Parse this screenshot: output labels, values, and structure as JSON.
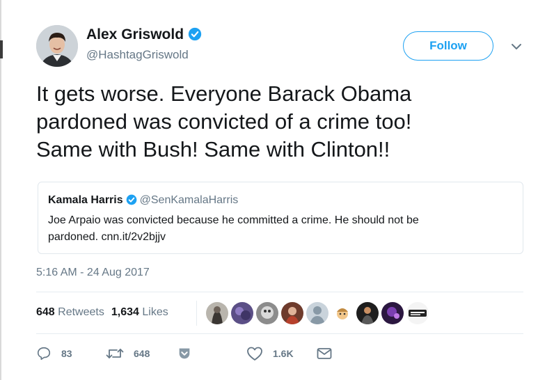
{
  "author": {
    "name": "Alex Griswold",
    "handle": "@HashtagGriswold",
    "verified": true
  },
  "follow_label": "Follow",
  "tweet": {
    "lines": [
      "It gets worse. Everyone Barack Obama",
      "pardoned was convicted of a crime too!",
      "Same with Bush! Same with Clinton!!"
    ]
  },
  "quoted": {
    "name": "Kamala Harris",
    "handle": "@SenKamalaHarris",
    "verified": true,
    "text_lines": [
      "Joe Arpaio was convicted because he committed a crime. He should not be",
      "pardoned. cnn.it/2v2bjjv"
    ]
  },
  "timestamp": "5:16 AM - 24 Aug 2017",
  "stats": {
    "retweets_count": "648",
    "retweets_label": "Retweets",
    "likes_count": "1,634",
    "likes_label": "Likes"
  },
  "actions": {
    "reply_count": "83",
    "retweet_count": "648",
    "like_count": "1.6K"
  },
  "icons": {
    "verified": "verified-badge-icon",
    "caret": "chevron-down-icon",
    "reply": "reply-icon",
    "retweet": "retweet-icon",
    "save": "save-icon",
    "like": "heart-icon",
    "message": "envelope-icon"
  },
  "colors": {
    "accent": "#1da1f2",
    "text": "#14171a",
    "muted": "#657786",
    "border": "#e1e8ed"
  }
}
